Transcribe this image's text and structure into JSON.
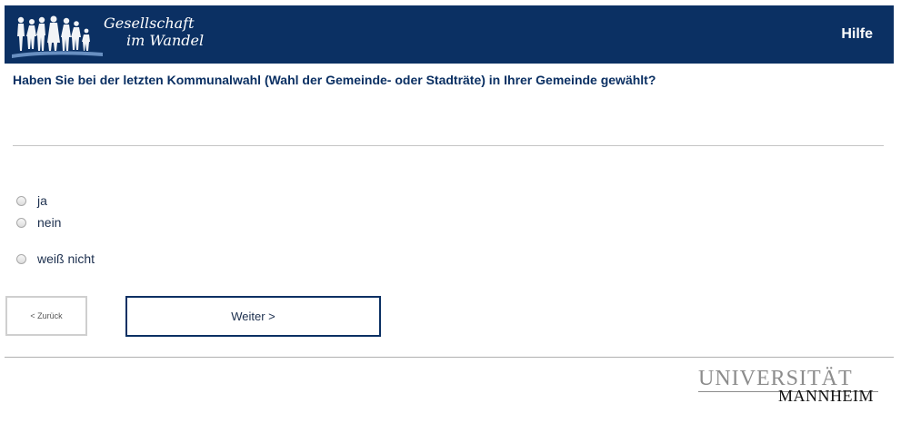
{
  "header": {
    "logo_line1": "Gesellschaft",
    "logo_line2": "im Wandel",
    "help_label": "Hilfe",
    "background_color": "#0b3063"
  },
  "question": {
    "text": "Haben Sie bei der letzten Kommunalwahl (Wahl der Gemeinde- oder Stadträte) in Ihrer Gemeinde gewählt?"
  },
  "options": [
    {
      "label": "ja",
      "selected": false
    },
    {
      "label": "nein",
      "selected": false
    },
    {
      "label": "weiß nicht",
      "selected": false
    }
  ],
  "navigation": {
    "back_label": "< Zurück",
    "next_label": "Weiter >"
  },
  "footer": {
    "logo_line1": "UNIVERSITÄT",
    "logo_line2": "MANNHEIM"
  }
}
